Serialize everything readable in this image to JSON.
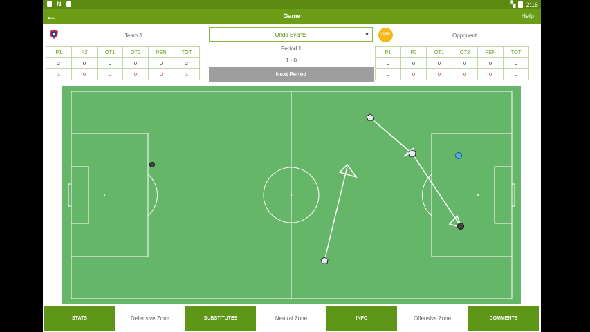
{
  "status_bar": {
    "time": "2:16"
  },
  "app_bar": {
    "title": "Game",
    "help_label": "Help"
  },
  "teams": {
    "home": {
      "name": "Team 1"
    },
    "away": {
      "name": "Opponent",
      "badge": "OPP"
    }
  },
  "controls": {
    "undo_label": "Undo Events",
    "period_label": "Period 1",
    "score": "1 - 0",
    "next_period_label": "Next Period"
  },
  "score_table": {
    "headers": [
      "P1",
      "P2",
      "OT1",
      "OT2",
      "PEN",
      "TOT"
    ],
    "home_rows": [
      [
        "2",
        "0",
        "0",
        "0",
        "0",
        "2"
      ],
      [
        "1",
        "0",
        "0",
        "0",
        "0",
        "1"
      ]
    ],
    "away_rows": [
      [
        "0",
        "0",
        "0",
        "0",
        "0",
        "0"
      ],
      [
        "0",
        "0",
        "0",
        "0",
        "0",
        "0"
      ]
    ]
  },
  "bottom_bar": {
    "stats_label": "STATS",
    "defensive_zone": "Defensive Zone",
    "substitutes_label": "SUBSTITUTES",
    "neutral_zone": "Neutral Zone",
    "info_label": "INFO",
    "offensive_zone": "Offensive Zone",
    "comments_label": "COMMENTS"
  },
  "colors": {
    "app_bar": "#6b9d16",
    "status_bar": "#5a8a12",
    "pitch": "#66b66a",
    "button": "#5e9718",
    "opp_badge": "#f4b81b",
    "next_period": "#9e9e9e"
  }
}
